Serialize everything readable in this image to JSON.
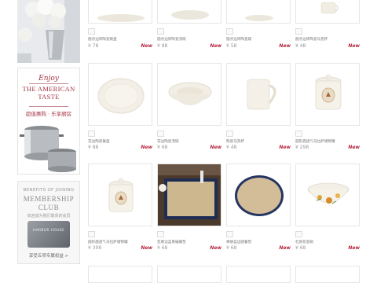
{
  "sidebar": {
    "taste": {
      "enjoy": "Enjoy",
      "title_line1": "THE AMERICAN",
      "title_line2": "TASTE",
      "subtitle": "超值惠购 · 乐享厨房"
    },
    "membership": {
      "small": "BENEFITS OF JOINING",
      "big_line1": "MEMBERSHIP",
      "big_line2": "CLUB",
      "note": "欢迎成为我们尊贵的会员",
      "card_text": "HARBOR HOUSE",
      "link": "享受五项专属权益 >"
    }
  },
  "products": [
    {
      "name": "圆点边饰陶瓷碗盘",
      "price": "¥ 78",
      "tag": "New"
    },
    {
      "name": "圆点边饰陶瓷汤碗",
      "price": "¥ 88",
      "tag": "New"
    },
    {
      "name": "圆点边饰陶瓷碟",
      "price": "¥ 58",
      "tag": "New"
    },
    {
      "name": "圆点边饰陶瓷马克杯",
      "price": "¥ 48",
      "tag": "New"
    },
    {
      "name": "花边陶瓷餐盘",
      "price": "¥ 88",
      "tag": "New"
    },
    {
      "name": "花边陶瓷汤碗",
      "price": "¥ 68",
      "tag": "New"
    },
    {
      "name": "陶瓷马克杯",
      "price": "¥ 48",
      "tag": "New"
    },
    {
      "name": "圆形鹿透气马拉萨储物罐",
      "price": "¥ 298",
      "tag": "New"
    },
    {
      "name": "圆形鹿透气马拉萨储物罐",
      "price": "¥ 398",
      "tag": "New"
    },
    {
      "name": "亚麻边蓝黄编餐垫",
      "price": "¥ 68",
      "tag": "New"
    },
    {
      "name": "棉质蓝边圆餐垫",
      "price": "¥ 68",
      "tag": "New"
    },
    {
      "name": "杜鹃花瓷碗",
      "price": "¥ 68",
      "tag": "New"
    }
  ]
}
